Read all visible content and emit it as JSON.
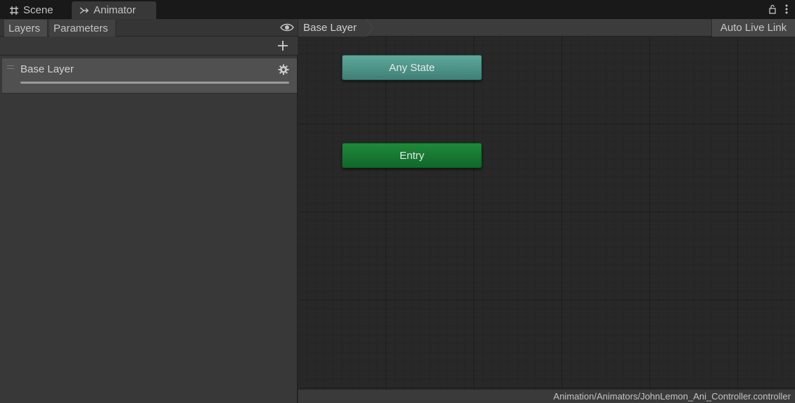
{
  "tabs": {
    "scene_label": "Scene",
    "animator_label": "Animator",
    "scene_icon": "grid-icon",
    "animator_icon": "animator-icon"
  },
  "window_controls": {
    "lock_icon": "lock-icon",
    "menu_icon": "kebab-menu-icon"
  },
  "left_panel": {
    "tabs": [
      {
        "label": "Layers"
      },
      {
        "label": "Parameters"
      }
    ],
    "eye_icon": "eye-icon",
    "add_icon": "plus-icon",
    "layers": [
      {
        "name": "Base Layer",
        "weight": 1.0
      }
    ]
  },
  "graph": {
    "breadcrumb": "Base Layer",
    "auto_live_link_label": "Auto Live Link",
    "nodes": [
      {
        "label": "Any State",
        "color": "#4f9488"
      },
      {
        "label": "Entry",
        "color": "#177a32"
      }
    ]
  },
  "status": {
    "asset_path": "Animation/Animators/JohnLemon_Ani_Controller.controller"
  }
}
